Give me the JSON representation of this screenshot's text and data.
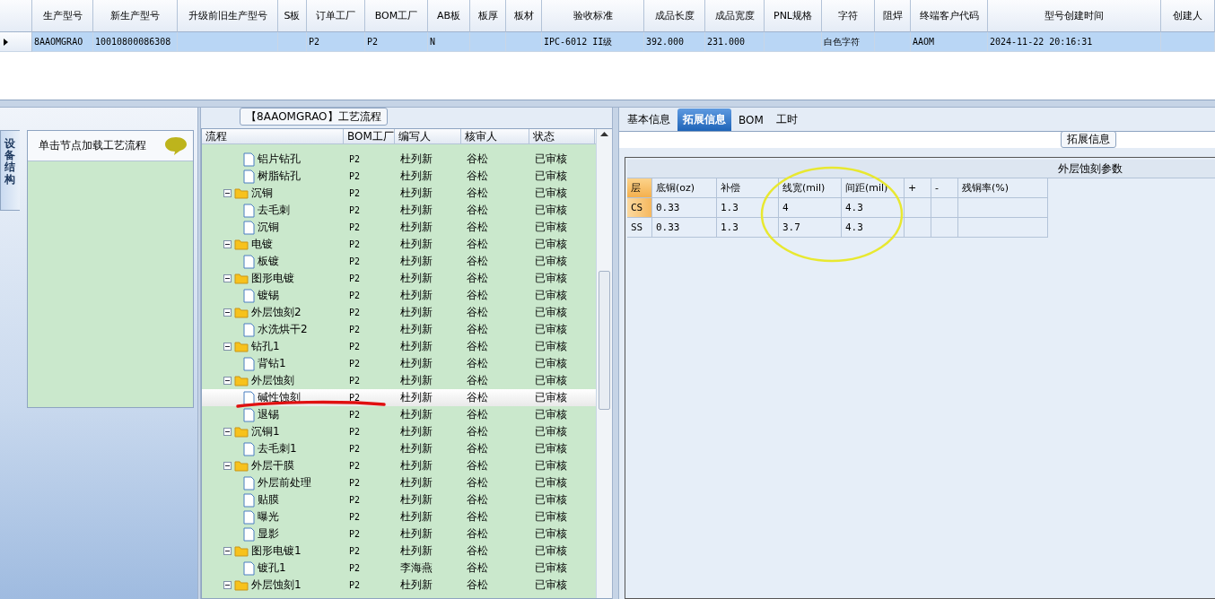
{
  "model_grid": {
    "columns": [
      "生产型号",
      "新生产型号",
      "升级前旧生产型号",
      "S板",
      "订单工厂",
      "BOM工厂",
      "AB板",
      "板厚",
      "板材",
      "验收标准",
      "成品长度",
      "成品宽度",
      "PNL规格",
      "字符",
      "阻焊",
      "终端客户代码",
      "型号创建时间",
      "创建人"
    ],
    "rows": [
      {
        "selected": true,
        "cells": [
          "8AAOMGRAO",
          "10010800086308",
          null,
          null,
          "P2",
          "P2",
          "N",
          null,
          null,
          "IPC-6012 II级",
          "392.000",
          "231.000",
          null,
          "白色字符",
          null,
          "AAOM",
          "2024-11-22 20:16:31",
          null
        ]
      }
    ]
  },
  "side_tab": {
    "label": "设备结构"
  },
  "equipment_panel": {
    "hint": "单击节点加载工艺流程"
  },
  "process_panel": {
    "title": "【8AAOMGRAO】工艺流程",
    "columns": [
      "流程",
      "BOM工厂",
      "编写人",
      "核审人",
      "状态"
    ],
    "items": [
      {
        "kind": "file",
        "name": "铝片钻孔",
        "bom": "P2",
        "author": "杜列新",
        "reviewer": "谷松",
        "status": "已审核",
        "selected": false
      },
      {
        "kind": "file",
        "name": "树脂钻孔",
        "bom": "P2",
        "author": "杜列新",
        "reviewer": "谷松",
        "status": "已审核",
        "selected": false
      },
      {
        "kind": "folder",
        "name": "沉铜",
        "bom": "P2",
        "author": "杜列新",
        "reviewer": "谷松",
        "status": "已审核",
        "selected": false,
        "expanded": true,
        "children": [
          {
            "kind": "file",
            "name": "去毛刺",
            "bom": "P2",
            "author": "杜列新",
            "reviewer": "谷松",
            "status": "已审核",
            "selected": false
          },
          {
            "kind": "file",
            "name": "沉铜",
            "bom": "P2",
            "author": "杜列新",
            "reviewer": "谷松",
            "status": "已审核",
            "selected": false
          }
        ]
      },
      {
        "kind": "folder",
        "name": "电镀",
        "bom": "P2",
        "author": "杜列新",
        "reviewer": "谷松",
        "status": "已审核",
        "selected": false,
        "expanded": true,
        "children": [
          {
            "kind": "file",
            "name": "板镀",
            "bom": "P2",
            "author": "杜列新",
            "reviewer": "谷松",
            "status": "已审核",
            "selected": false
          }
        ]
      },
      {
        "kind": "folder",
        "name": "图形电镀",
        "bom": "P2",
        "author": "杜列新",
        "reviewer": "谷松",
        "status": "已审核",
        "selected": false,
        "expanded": true,
        "children": [
          {
            "kind": "file",
            "name": "镀锡",
            "bom": "P2",
            "author": "杜列新",
            "reviewer": "谷松",
            "status": "已审核",
            "selected": false
          }
        ]
      },
      {
        "kind": "folder",
        "name": "外层蚀刻2",
        "bom": "P2",
        "author": "杜列新",
        "reviewer": "谷松",
        "status": "已审核",
        "selected": false,
        "expanded": true,
        "children": [
          {
            "kind": "file",
            "name": "水洗烘干2",
            "bom": "P2",
            "author": "杜列新",
            "reviewer": "谷松",
            "status": "已审核",
            "selected": false
          }
        ]
      },
      {
        "kind": "folder",
        "name": "钻孔1",
        "bom": "P2",
        "author": "杜列新",
        "reviewer": "谷松",
        "status": "已审核",
        "selected": false,
        "expanded": true,
        "children": [
          {
            "kind": "file",
            "name": "背钻1",
            "bom": "P2",
            "author": "杜列新",
            "reviewer": "谷松",
            "status": "已审核",
            "selected": false
          }
        ]
      },
      {
        "kind": "folder",
        "name": "外层蚀刻",
        "bom": "P2",
        "author": "杜列新",
        "reviewer": "谷松",
        "status": "已审核",
        "selected": false,
        "expanded": true,
        "children": [
          {
            "kind": "file",
            "name": "碱性蚀刻",
            "bom": "P2",
            "author": "杜列新",
            "reviewer": "谷松",
            "status": "已审核",
            "selected": true
          },
          {
            "kind": "file",
            "name": "退锡",
            "bom": "P2",
            "author": "杜列新",
            "reviewer": "谷松",
            "status": "已审核",
            "selected": false
          }
        ]
      },
      {
        "kind": "folder",
        "name": "沉铜1",
        "bom": "P2",
        "author": "杜列新",
        "reviewer": "谷松",
        "status": "已审核",
        "selected": false,
        "expanded": true,
        "children": [
          {
            "kind": "file",
            "name": "去毛刺1",
            "bom": "P2",
            "author": "杜列新",
            "reviewer": "谷松",
            "status": "已审核",
            "selected": false
          }
        ]
      },
      {
        "kind": "folder",
        "name": "外层干膜",
        "bom": "P2",
        "author": "杜列新",
        "reviewer": "谷松",
        "status": "已审核",
        "selected": false,
        "expanded": true,
        "children": [
          {
            "kind": "file",
            "name": "外层前处理",
            "bom": "P2",
            "author": "杜列新",
            "reviewer": "谷松",
            "status": "已审核",
            "selected": false
          },
          {
            "kind": "file",
            "name": "贴膜",
            "bom": "P2",
            "author": "杜列新",
            "reviewer": "谷松",
            "status": "已审核",
            "selected": false
          },
          {
            "kind": "file",
            "name": "曝光",
            "bom": "P2",
            "author": "杜列新",
            "reviewer": "谷松",
            "status": "已审核",
            "selected": false
          },
          {
            "kind": "file",
            "name": "显影",
            "bom": "P2",
            "author": "杜列新",
            "reviewer": "谷松",
            "status": "已审核",
            "selected": false
          }
        ]
      },
      {
        "kind": "folder",
        "name": "图形电镀1",
        "bom": "P2",
        "author": "杜列新",
        "reviewer": "谷松",
        "status": "已审核",
        "selected": false,
        "expanded": true,
        "children": [
          {
            "kind": "file",
            "name": "镀孔1",
            "bom": "P2",
            "author": "李海燕",
            "reviewer": "谷松",
            "status": "已审核",
            "selected": false
          }
        ]
      },
      {
        "kind": "folder",
        "name": "外层蚀刻1",
        "bom": "P2",
        "author": "杜列新",
        "reviewer": "谷松",
        "status": "已审核",
        "selected": false,
        "expanded": true
      }
    ]
  },
  "detail_tabs": [
    {
      "label": "基本信息",
      "selected": false
    },
    {
      "label": "拓展信息",
      "selected": true
    },
    {
      "label": "BOM",
      "selected": false
    },
    {
      "label": "工时",
      "selected": false
    }
  ],
  "extended_info": {
    "group_title": "拓展信息",
    "table_title": "外层蚀刻参数",
    "columns": [
      "层",
      "底铜(oz)",
      "补偿",
      "线宽(mil)",
      "间距(mil)",
      "+",
      "-",
      "残铜率(%)"
    ],
    "rows": [
      {
        "selected": true,
        "cells": [
          "CS",
          "0.33",
          "1.3",
          "4",
          "4.3"
        ]
      },
      {
        "selected": false,
        "cells": [
          "SS",
          "0.33",
          "1.3",
          "3.7",
          "4.3"
        ]
      }
    ]
  }
}
